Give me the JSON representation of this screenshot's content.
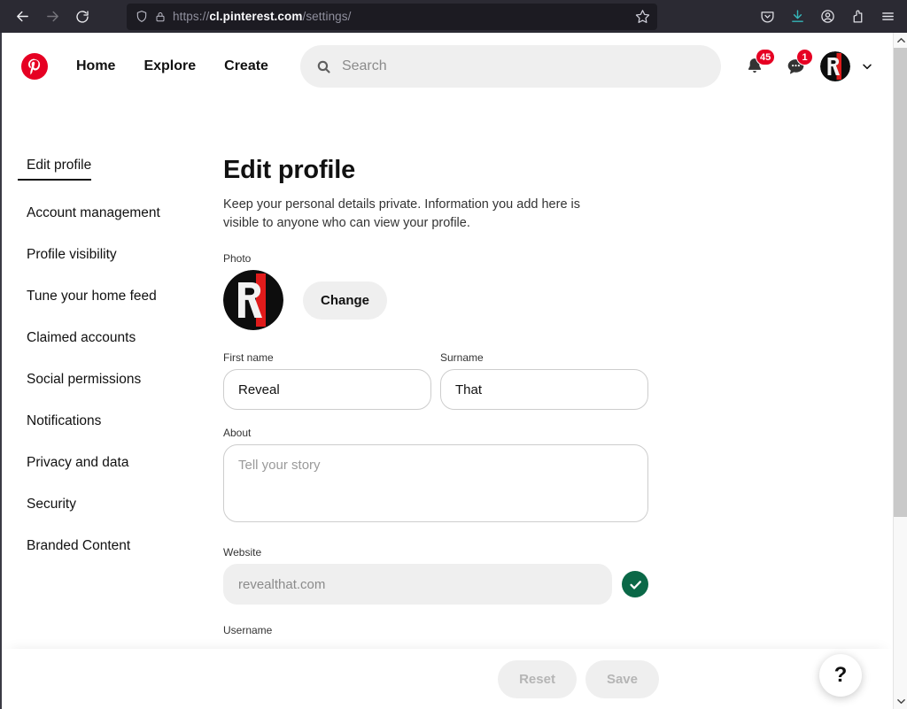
{
  "browser": {
    "url_prefix": "https://",
    "url_host": "cl.pinterest.com",
    "url_path": "/settings/",
    "back_icon": "back-arrow-icon",
    "forward_icon": "forward-arrow-icon",
    "reload_icon": "reload-icon",
    "shield_icon": "shield-icon",
    "lock_icon": "padlock-icon",
    "bookmark_icon": "star-icon",
    "toolbar_icons": [
      "pocket-icon",
      "downloads-icon",
      "account-icon",
      "extensions-icon",
      "hamburger-menu-icon"
    ]
  },
  "header": {
    "logo": "pinterest-logo-icon",
    "nav": [
      {
        "label": "Home"
      },
      {
        "label": "Explore"
      },
      {
        "label": "Create"
      }
    ],
    "search": {
      "placeholder": "Search",
      "icon": "search-icon"
    },
    "notifications": {
      "icon": "bell-icon",
      "badge": "45"
    },
    "messages": {
      "icon": "chat-bubble-icon",
      "badge": "1"
    },
    "avatar": "user-avatar",
    "chevron": "chevron-down-icon"
  },
  "sidebar": {
    "items": [
      {
        "label": "Edit profile",
        "active": true
      },
      {
        "label": "Account management",
        "active": false
      },
      {
        "label": "Profile visibility",
        "active": false
      },
      {
        "label": "Tune your home feed",
        "active": false
      },
      {
        "label": "Claimed accounts",
        "active": false
      },
      {
        "label": "Social permissions",
        "active": false
      },
      {
        "label": "Notifications",
        "active": false
      },
      {
        "label": "Privacy and data",
        "active": false
      },
      {
        "label": "Security",
        "active": false
      },
      {
        "label": "Branded Content",
        "active": false
      }
    ]
  },
  "main": {
    "title": "Edit profile",
    "description": "Keep your personal details private. Information you add here is visible to anyone who can view your profile.",
    "photo": {
      "label": "Photo",
      "change_button": "Change"
    },
    "first_name": {
      "label": "First name",
      "value": "Reveal"
    },
    "surname": {
      "label": "Surname",
      "value": "That"
    },
    "about": {
      "label": "About",
      "value": "",
      "placeholder": "Tell your story"
    },
    "website": {
      "label": "Website",
      "value": "",
      "placeholder": "revealthat.com",
      "verified_icon": "check-circle-icon",
      "verified_color": "#0a6847"
    },
    "username": {
      "label": "Username"
    }
  },
  "footer": {
    "reset_label": "Reset",
    "save_label": "Save"
  },
  "help": {
    "label": "?",
    "icon": "question-mark-icon"
  },
  "scrollbar": {
    "up_icon": "scroll-up-arrow-icon",
    "down_icon": "scroll-down-arrow-icon"
  },
  "colors": {
    "brand_red": "#e60023",
    "chrome_bg": "#2b2a33",
    "urlbar_bg": "#1c1b22",
    "verified_green": "#0a6847"
  }
}
